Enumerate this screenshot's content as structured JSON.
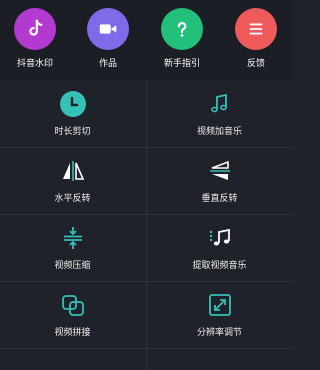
{
  "top_nav": [
    {
      "label": "抖音水印",
      "icon": "tiktok-icon",
      "color": "#b23ad0"
    },
    {
      "label": "作品",
      "icon": "video-camera-icon",
      "color": "#7d6bea"
    },
    {
      "label": "新手指引",
      "icon": "question-icon",
      "color": "#22c07a"
    },
    {
      "label": "反馈",
      "icon": "menu-icon",
      "color": "#ef5b5b"
    }
  ],
  "tools": [
    {
      "label": "时长剪切",
      "icon": "clock-icon"
    },
    {
      "label": "视频加音乐",
      "icon": "music-note-icon"
    },
    {
      "label": "水平反转",
      "icon": "flip-horizontal-icon"
    },
    {
      "label": "垂直反转",
      "icon": "flip-vertical-icon"
    },
    {
      "label": "视频压缩",
      "icon": "compress-icon"
    },
    {
      "label": "提取视频音乐",
      "icon": "music-extract-icon"
    },
    {
      "label": "视频拼接",
      "icon": "merge-icon"
    },
    {
      "label": "分辨率调节",
      "icon": "resolution-icon"
    }
  ],
  "colors": {
    "accent": "#35c0b8",
    "background": "#1f2229"
  }
}
